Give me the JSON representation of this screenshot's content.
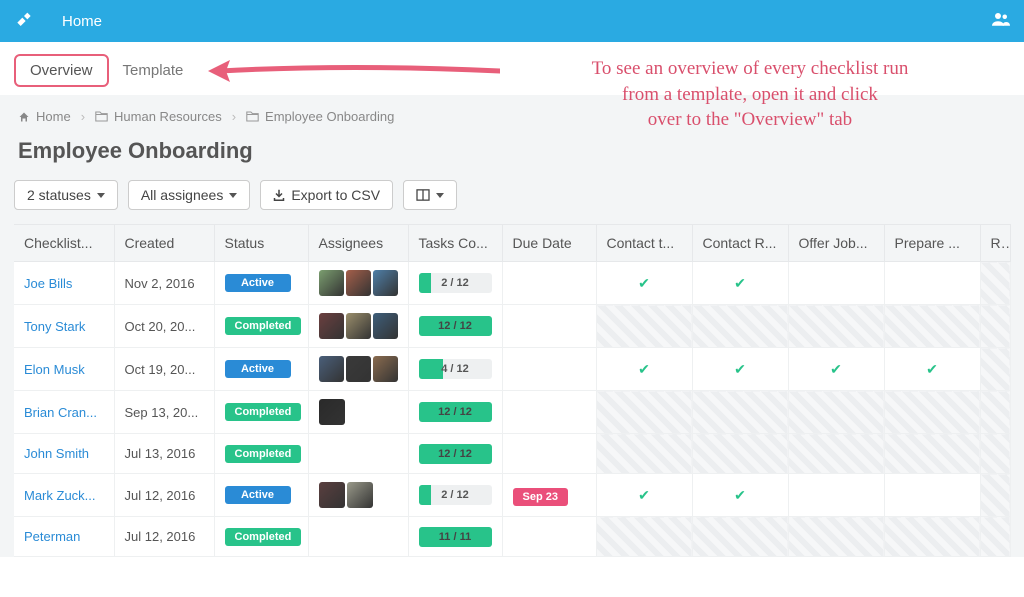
{
  "topbar": {
    "home": "Home"
  },
  "tabs": {
    "overview": "Overview",
    "template": "Template"
  },
  "annotation": {
    "line1": "To see an overview of every checklist run",
    "line2": "from a template, open it and click",
    "line3": "over to the \"Overview\" tab"
  },
  "breadcrumb": {
    "home": "Home",
    "hr": "Human Resources",
    "emp": "Employee Onboarding"
  },
  "page_title": "Employee Onboarding",
  "filters": {
    "statuses": "2 statuses",
    "assignees": "All assignees",
    "export": "Export to CSV"
  },
  "columns": {
    "checklist": "Checklist...",
    "created": "Created",
    "status": "Status",
    "assignees": "Assignees",
    "tasks": "Tasks Co...",
    "due": "Due Date",
    "contact_t": "Contact t...",
    "contact_r": "Contact R...",
    "offer": "Offer Job...",
    "prepare": "Prepare ...",
    "r": "R"
  },
  "rows": [
    {
      "name": "Joe Bills",
      "created": "Nov 2, 2016",
      "status": "Active",
      "status_class": "active",
      "avatars": [
        "#7b9e6f",
        "#a55f4a",
        "#4f7fa8"
      ],
      "tasks_label": "2 / 12",
      "tasks_pct": 17,
      "tasks_full": false,
      "due": "",
      "checks": [
        true,
        true,
        false,
        false
      ],
      "hatched": [
        false,
        false,
        false,
        false,
        true
      ]
    },
    {
      "name": "Tony Stark",
      "created": "Oct 20, 20...",
      "status": "Completed",
      "status_class": "completed",
      "avatars": [
        "#6b3f3f",
        "#9a8e6b",
        "#3e5e7a"
      ],
      "tasks_label": "12 / 12",
      "tasks_pct": 100,
      "tasks_full": true,
      "due": "",
      "checks": [
        false,
        false,
        false,
        false
      ],
      "hatched": [
        true,
        true,
        true,
        true,
        true
      ]
    },
    {
      "name": "Elon Musk",
      "created": "Oct 19, 20...",
      "status": "Active",
      "status_class": "active",
      "avatars": [
        "#4a5f7a",
        "#3a3a3a",
        "#8a6b4f"
      ],
      "tasks_label": "4 / 12",
      "tasks_pct": 33,
      "tasks_full": false,
      "due": "",
      "checks": [
        true,
        true,
        true,
        true
      ],
      "hatched": [
        false,
        false,
        false,
        false,
        true
      ]
    },
    {
      "name": "Brian Cran...",
      "created": "Sep 13, 20...",
      "status": "Completed",
      "status_class": "completed",
      "avatars": [
        "#2a2a2a"
      ],
      "tasks_label": "12 / 12",
      "tasks_pct": 100,
      "tasks_full": true,
      "due": "",
      "checks": [
        false,
        false,
        false,
        false
      ],
      "hatched": [
        true,
        true,
        true,
        true,
        true
      ]
    },
    {
      "name": "John Smith",
      "created": "Jul 13, 2016",
      "status": "Completed",
      "status_class": "completed",
      "avatars": [],
      "tasks_label": "12 / 12",
      "tasks_pct": 100,
      "tasks_full": true,
      "due": "",
      "checks": [
        false,
        false,
        false,
        false
      ],
      "hatched": [
        true,
        true,
        true,
        true,
        true
      ]
    },
    {
      "name": "Mark Zuck...",
      "created": "Jul 12, 2016",
      "status": "Active",
      "status_class": "active",
      "avatars": [
        "#5a3f3f",
        "#9a9a8a"
      ],
      "tasks_label": "2 / 12",
      "tasks_pct": 17,
      "tasks_full": false,
      "due": "Sep 23",
      "checks": [
        true,
        true,
        false,
        false
      ],
      "hatched": [
        false,
        false,
        false,
        false,
        true
      ]
    },
    {
      "name": "Peterman",
      "created": "Jul 12, 2016",
      "status": "Completed",
      "status_class": "completed",
      "avatars": [],
      "tasks_label": "11 / 11",
      "tasks_pct": 100,
      "tasks_full": true,
      "due": "",
      "checks": [
        false,
        false,
        false,
        false
      ],
      "hatched": [
        true,
        true,
        true,
        true,
        true
      ]
    }
  ]
}
